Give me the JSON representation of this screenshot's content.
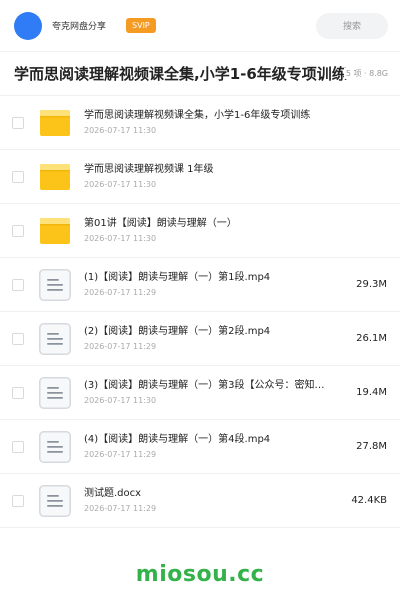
{
  "header": {
    "user_name": "夸克网盘分享",
    "badge": "SVIP",
    "search_placeholder": "搜索"
  },
  "share": {
    "title": "学而思阅读理解视频课全集,小学1-6年级专项训练",
    "meta": "5 项 · 8.8G"
  },
  "files": [
    {
      "type": "folder",
      "icon": "folder-icon",
      "name": "学而思阅读理解视频课全集，小学1-6年级专项训练",
      "date": "2026-07-17 11:30",
      "size": ""
    },
    {
      "type": "folder",
      "icon": "folder-icon",
      "name": "学而思阅读理解视频课 1年级",
      "date": "2026-07-17 11:30",
      "size": ""
    },
    {
      "type": "folder",
      "icon": "folder-icon",
      "name": "第01讲【阅读】朗读与理解（一）",
      "date": "2026-07-17 11:30",
      "size": ""
    },
    {
      "type": "file",
      "icon": "document-icon",
      "name": "(1)【阅读】朗读与理解（一）第1段.mp4",
      "date": "2026-07-17 11:29",
      "size": "29.3M"
    },
    {
      "type": "file",
      "icon": "document-icon",
      "name": "(2)【阅读】朗读与理解（一）第2段.mp4",
      "date": "2026-07-17 11:29",
      "size": "26.1M"
    },
    {
      "type": "file",
      "icon": "document-icon",
      "name": "(3)【阅读】朗读与理解（一）第3段【公众号：密知…",
      "date": "2026-07-17 11:30",
      "size": "19.4M"
    },
    {
      "type": "file",
      "icon": "document-icon",
      "name": "(4)【阅读】朗读与理解（一）第4段.mp4",
      "date": "2026-07-17 11:29",
      "size": "27.8M"
    },
    {
      "type": "file",
      "icon": "document-icon",
      "name": "测试题.docx",
      "date": "2026-07-17 11:29",
      "size": "42.4KB"
    }
  ],
  "watermark": "miosou.cc",
  "colors": {
    "avatar": "#2f7cf6",
    "badge": "#f59a23",
    "folder": "#fcc419",
    "watermark": "#33b24a"
  }
}
